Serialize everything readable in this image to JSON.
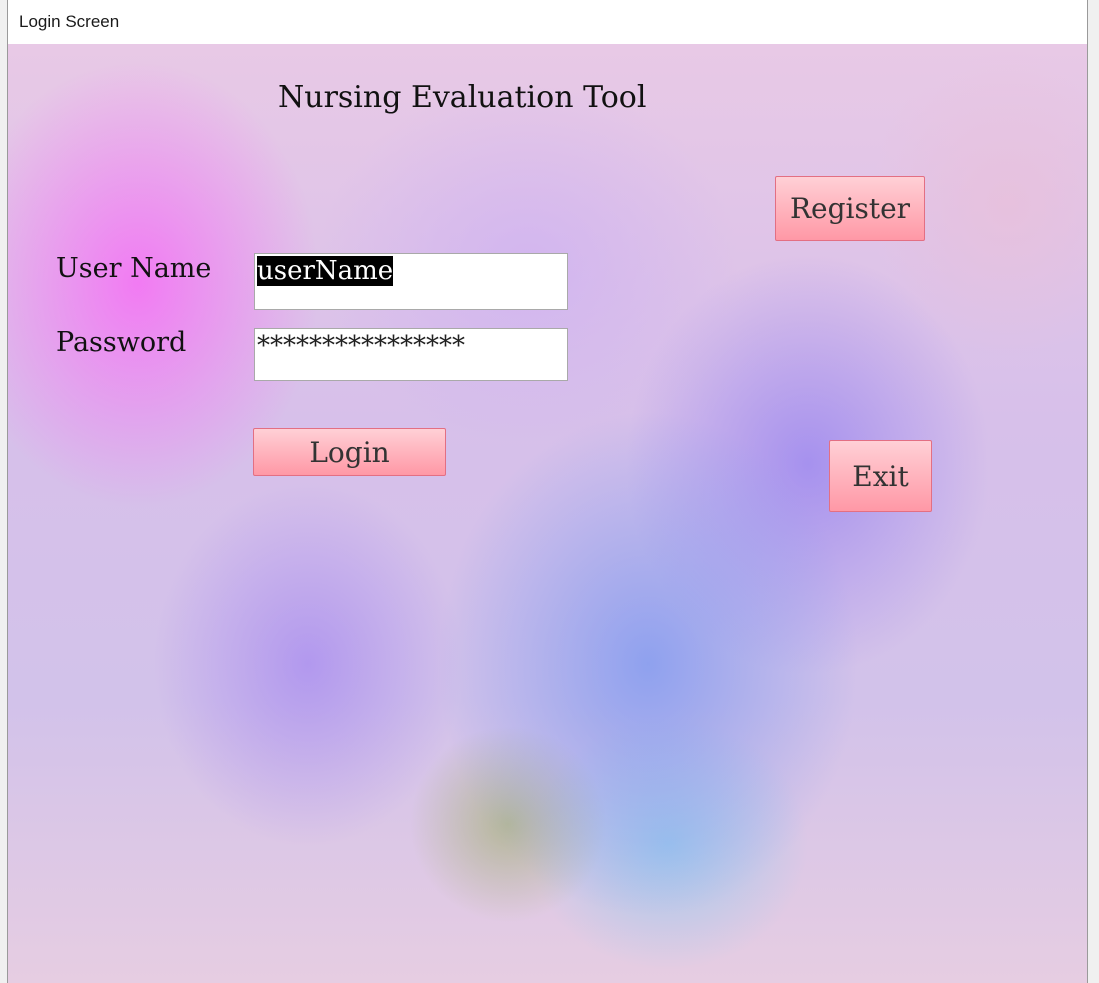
{
  "window": {
    "title": "Login Screen"
  },
  "form": {
    "heading": "Nursing Evaluation Tool",
    "username_label": "User Name",
    "username_value": "userName",
    "password_label": "Password",
    "password_value": "****************",
    "login_label": "Login",
    "register_label": "Register",
    "exit_label": "Exit"
  }
}
